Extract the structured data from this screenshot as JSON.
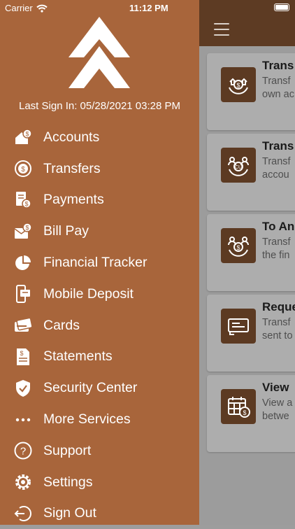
{
  "status_bar": {
    "carrier": "Carrier",
    "time": "11:12 PM"
  },
  "drawer": {
    "last_signin": "Last Sign In: 05/28/2021 03:28 PM",
    "items": [
      {
        "label": "Accounts",
        "icon": "house-dollar-icon"
      },
      {
        "label": "Transfers",
        "icon": "transfer-icon"
      },
      {
        "label": "Payments",
        "icon": "payments-icon"
      },
      {
        "label": "Bill Pay",
        "icon": "bill-pay-icon"
      },
      {
        "label": "Financial Tracker",
        "icon": "pie-chart-icon"
      },
      {
        "label": "Mobile Deposit",
        "icon": "mobile-deposit-icon"
      },
      {
        "label": "Cards",
        "icon": "cards-icon"
      },
      {
        "label": "Statements",
        "icon": "statement-icon"
      },
      {
        "label": "Security Center",
        "icon": "shield-icon"
      },
      {
        "label": "More Services",
        "icon": "more-icon"
      },
      {
        "label": "Support",
        "icon": "help-icon"
      },
      {
        "label": "Settings",
        "icon": "gear-icon"
      },
      {
        "label": "Sign Out",
        "icon": "sign-out-icon"
      }
    ]
  },
  "main": {
    "cards": [
      {
        "title": "Trans",
        "desc1": "Transf",
        "desc2": "own ac",
        "icon": "home-transfer-icon"
      },
      {
        "title": "Trans",
        "desc1": "Transf",
        "desc2": "accou",
        "icon": "member-transfer-icon"
      },
      {
        "title": "To An",
        "desc1": "Transf",
        "desc2": "the fin",
        "icon": "person-transfer-icon"
      },
      {
        "title": "Reque",
        "desc1": "Transf",
        "desc2": "sent to",
        "icon": "check-request-icon"
      },
      {
        "title": "View",
        "desc1": "View a",
        "desc2": "betwe",
        "icon": "calendar-dollar-icon"
      }
    ]
  },
  "colors": {
    "drawer": "#a8653b",
    "header": "#5d3b23",
    "card_icon": "#5c3a22"
  }
}
